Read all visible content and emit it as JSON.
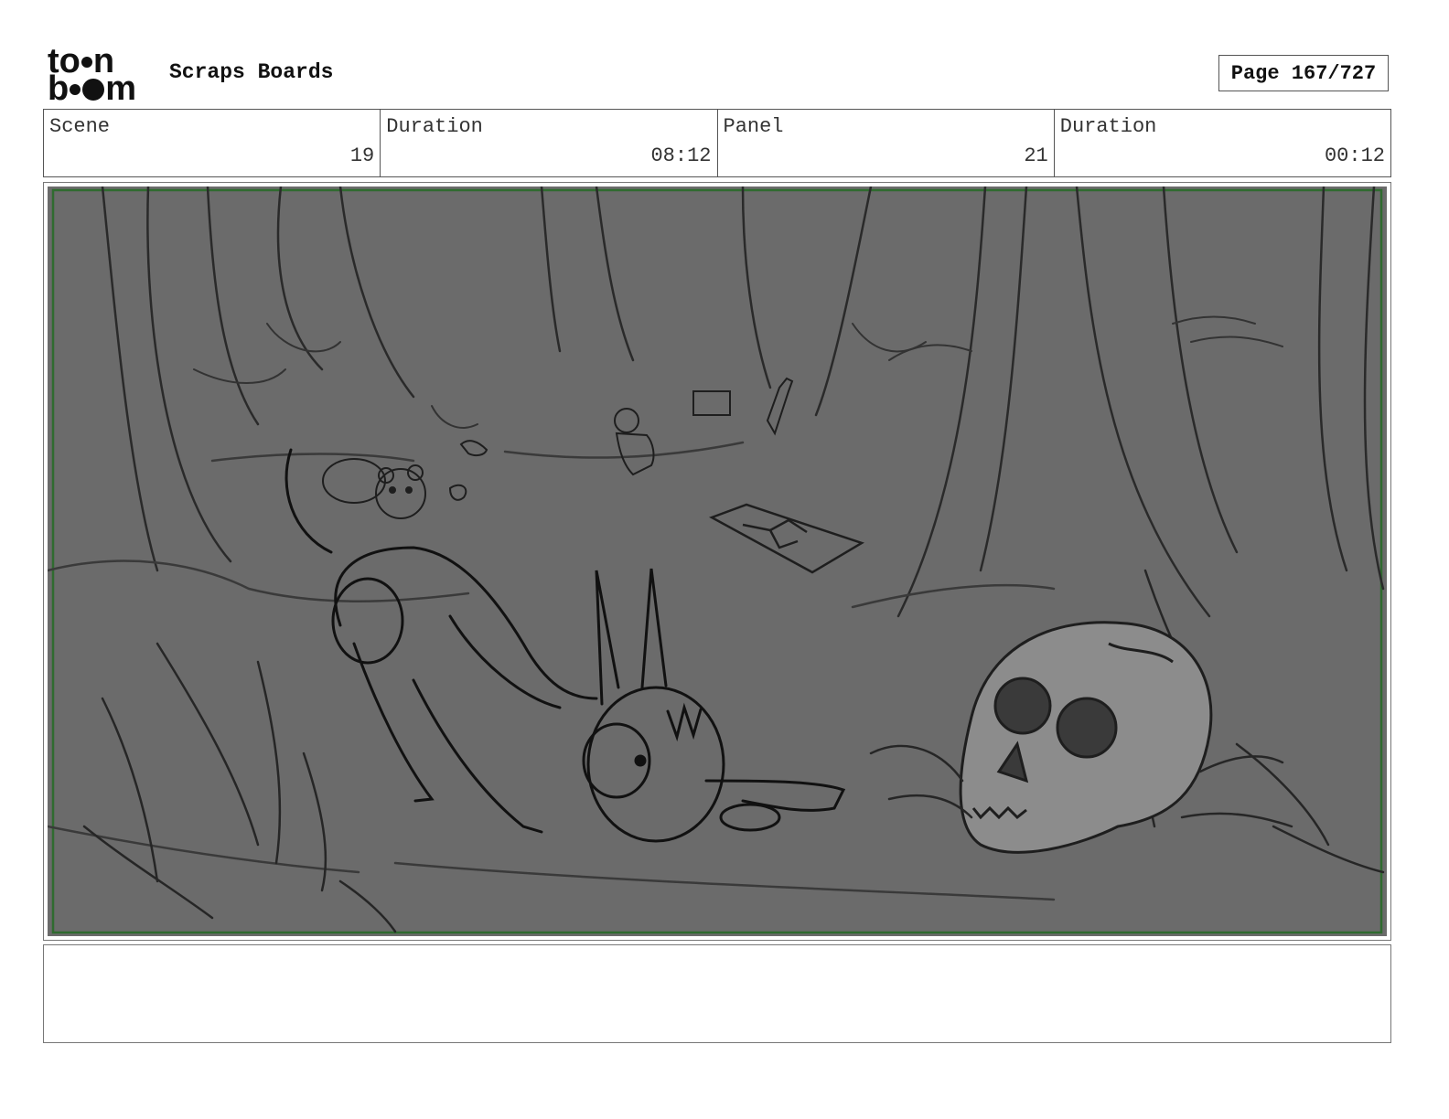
{
  "header": {
    "logo_top": "to",
    "logo_top_end": "n",
    "logo_bottom_start": "b",
    "logo_bottom_end": "m",
    "title": "Scraps Boards",
    "page": "Page 167/727"
  },
  "info": {
    "scene_label": "Scene",
    "scene_value": "19",
    "duration_label": "Duration",
    "duration_value": "08:12",
    "panel_label": "Panel",
    "panel_value": "21",
    "panel_duration_label": "Duration",
    "panel_duration_value": "00:12"
  },
  "colors": {
    "panel_bg": "#6b6b6b",
    "safe_frame": "#2f6b2f",
    "sketch_line": "#1e1e1e"
  }
}
